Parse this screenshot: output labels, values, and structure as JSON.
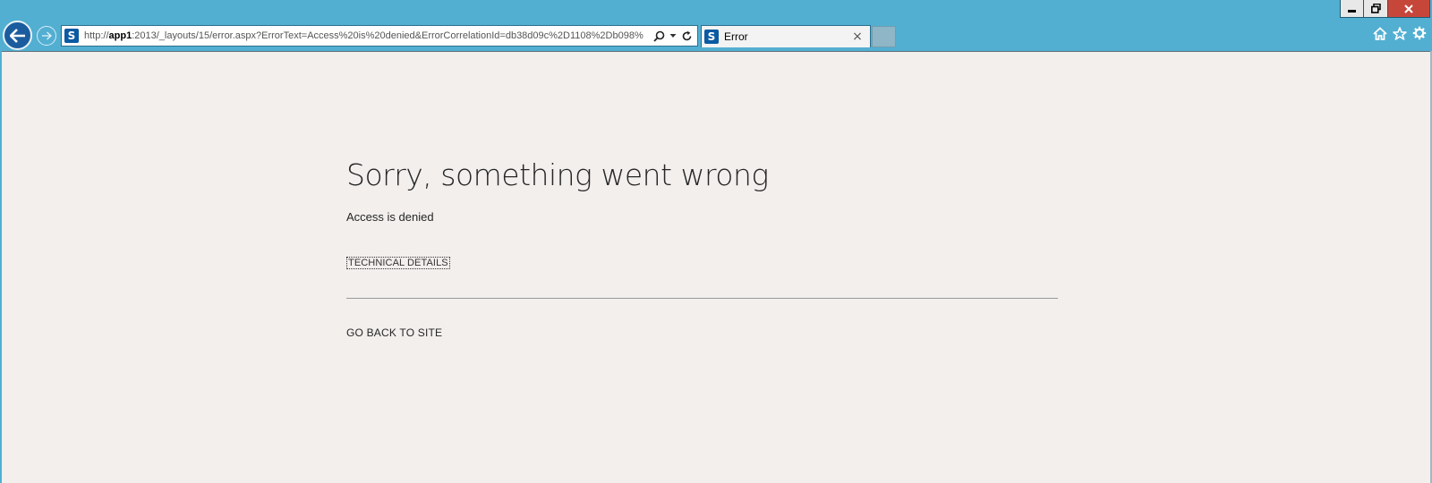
{
  "browser": {
    "url_prefix": "http://",
    "url_host": "app1",
    "url_rest": ":2013/_layouts/15/error.aspx?ErrorText=Access%20is%20denied&ErrorCorrelationId=db38d09c%2D1108%2Db098%",
    "site_icon_letter": "S",
    "tab_label": "Error",
    "tab_close": "×",
    "icons": {
      "back": "back-arrow-icon",
      "forward": "forward-arrow-icon",
      "search": "search-icon",
      "dropdown": "chevron-down-icon",
      "refresh": "refresh-icon",
      "home": "home-icon",
      "favorites": "star-icon",
      "settings": "gear-icon"
    },
    "colors": {
      "chrome": "#52afd2",
      "close": "#c7463a",
      "back_button": "#1b5c9e",
      "sharepoint": "#0b5aa2"
    }
  },
  "page": {
    "title": "Sorry, something went wrong",
    "message": "Access is denied",
    "technical_details": "TECHNICAL DETAILS",
    "go_back": "GO BACK TO SITE",
    "background": "#f2efed"
  }
}
